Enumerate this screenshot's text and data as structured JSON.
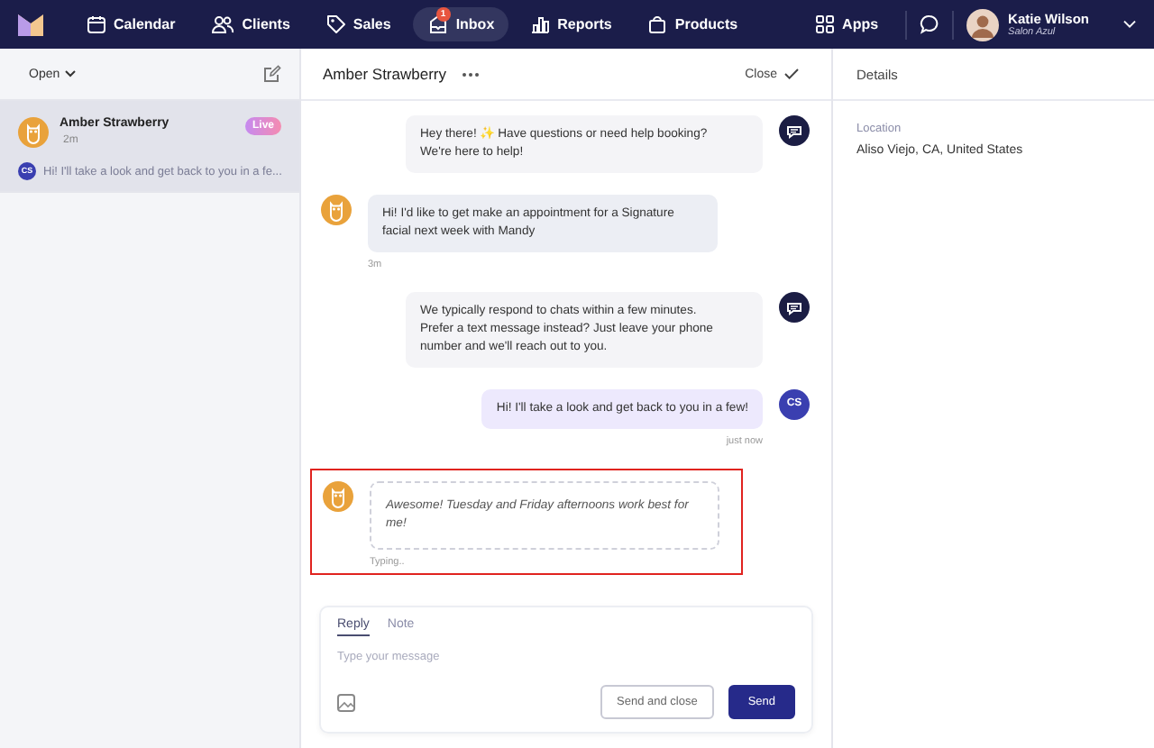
{
  "nav": {
    "items": [
      {
        "label": "Calendar",
        "selected": false
      },
      {
        "label": "Clients",
        "selected": false
      },
      {
        "label": "Sales",
        "selected": false
      },
      {
        "label": "Inbox",
        "selected": true,
        "badge": "1"
      },
      {
        "label": "Reports",
        "selected": false
      },
      {
        "label": "Products",
        "selected": false
      }
    ],
    "apps": "Apps",
    "user": {
      "name": "Katie Wilson",
      "subtitle": "Salon Azul"
    }
  },
  "inbox": {
    "filter": "Open",
    "conversations": [
      {
        "name": "Amber Strawberry",
        "time": "2m",
        "status": "Live",
        "preview_initials": "CS",
        "preview": "Hi! I'll take a look and get back to you in a fe...",
        "selected": true
      }
    ]
  },
  "chat": {
    "title": "Amber Strawberry",
    "close": "Close",
    "messages": [
      {
        "kind": "bot",
        "text": "Hey there! ✨ Have questions or need help booking? We're here to help!"
      },
      {
        "kind": "customer",
        "text": "Hi! I'd like to get make an appointment for a Signature facial next week with Mandy",
        "time": "3m"
      },
      {
        "kind": "bot",
        "text": "We typically respond to chats within a few minutes. Prefer a text message instead? Just leave your phone number and we'll reach out to you."
      },
      {
        "kind": "staff",
        "initials": "CS",
        "text": "Hi! I'll take a look and get back to you in a few!",
        "time": "just now"
      },
      {
        "kind": "typing",
        "text": "Awesome! Tuesday and Friday afternoons work best for me!",
        "status": "Typing..",
        "highlighted": true
      }
    ],
    "composer": {
      "tabs": [
        {
          "label": "Reply",
          "selected": true
        },
        {
          "label": "Note",
          "selected": false
        }
      ],
      "placeholder": "Type your message",
      "buttons": [
        {
          "label": "Send and close",
          "kind": "secondary"
        },
        {
          "label": "Send",
          "kind": "primary"
        }
      ]
    }
  },
  "details": {
    "title": "Details",
    "fields": [
      {
        "label": "Location",
        "value": "Aliso Viejo, CA, United States"
      }
    ]
  }
}
